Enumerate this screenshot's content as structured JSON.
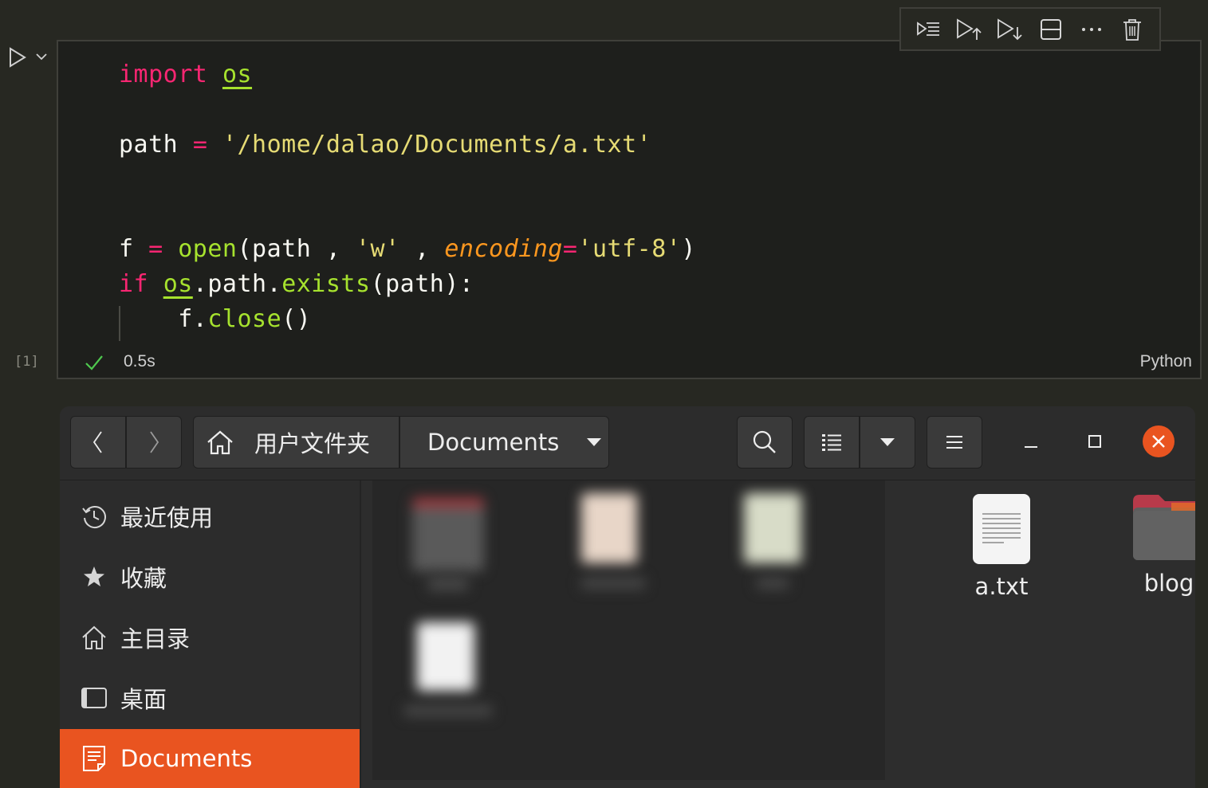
{
  "notebook": {
    "execution_count": "[1]",
    "status": {
      "time": "0.5s",
      "language": "Python"
    },
    "code_lines": {
      "l1_kw": "import",
      "l1_sp": " ",
      "l1_mod": "os",
      "l2_a": "path ",
      "l2_op": "=",
      "l2_sp": " ",
      "l2_str": "'/home/dalao/Documents/a.txt'",
      "l3_a": "f ",
      "l3_op": "=",
      "l3_sp": " ",
      "l3_fn": "open",
      "l3_b": "(path , ",
      "l3_str1": "'w'",
      "l3_c": " , ",
      "l3_param": "encoding",
      "l3_op2": "=",
      "l3_str2": "'utf-8'",
      "l3_d": ")",
      "l4_kw": "if",
      "l4_sp": " ",
      "l4_mod": "os",
      "l4_a": ".path.",
      "l4_fn": "exists",
      "l4_b": "(path):",
      "l5_a": "    f.",
      "l5_fn": "close",
      "l5_b": "()"
    },
    "toolbar_icons": [
      "run-by-line-icon",
      "execute-above-icon",
      "execute-below-icon",
      "split-cell-icon",
      "more-icon",
      "delete-icon"
    ]
  },
  "file_manager": {
    "path": {
      "home_label": "用户文件夹",
      "current_folder": "Documents"
    },
    "sidebar": {
      "items": [
        {
          "label": "最近使用",
          "icon": "clock-icon"
        },
        {
          "label": "收藏",
          "icon": "star-icon"
        },
        {
          "label": "主目录",
          "icon": "home-icon"
        },
        {
          "label": "桌面",
          "icon": "desktop-icon"
        },
        {
          "label": "Documents",
          "icon": "document-icon",
          "active": true
        }
      ]
    },
    "files": [
      {
        "name": "a.txt",
        "icon": "text-file-icon"
      },
      {
        "name": "blog",
        "icon": "folder-icon"
      }
    ],
    "colors": {
      "accent": "#e95420",
      "close_button": "#e95420"
    }
  }
}
